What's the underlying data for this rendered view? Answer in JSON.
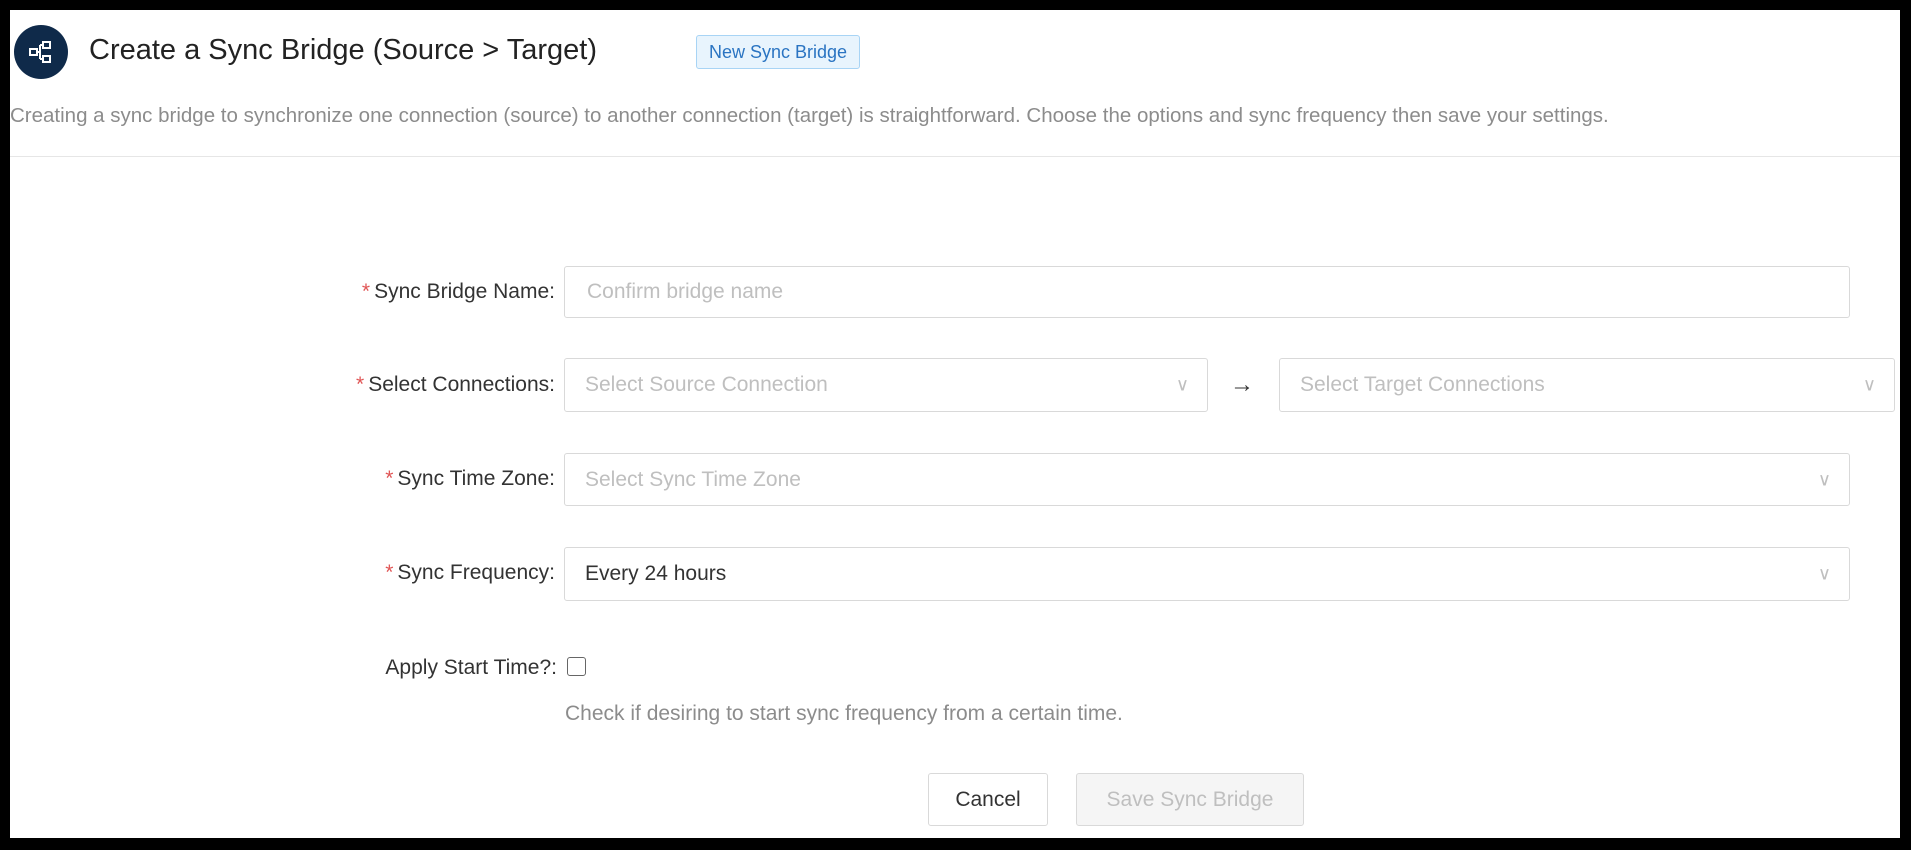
{
  "header": {
    "icon": "sync-bridge-nodes-icon",
    "title": "Create a Sync Bridge (Source > Target)",
    "badge": "New Sync Bridge",
    "description": "Creating a sync bridge to synchronize one connection (source) to another connection (target) is straightforward. Choose the options and sync frequency then save your settings."
  },
  "form": {
    "required_mark": "*",
    "name": {
      "label": "Sync Bridge Name",
      "placeholder": "Confirm bridge name",
      "value": ""
    },
    "connections": {
      "label": "Select Connections",
      "source_placeholder": "Select Source Connection",
      "target_placeholder": "Select Target Connections",
      "arrow": "→"
    },
    "time_zone": {
      "label": "Sync Time Zone",
      "placeholder": "Select Sync Time Zone"
    },
    "frequency": {
      "label": "Sync Frequency",
      "value": "Every 24 hours"
    },
    "start_time": {
      "label": "Apply Start Time?",
      "checked": false,
      "help": "Check if desiring to start sync frequency from a certain time."
    },
    "colon": ":"
  },
  "buttons": {
    "cancel": "Cancel",
    "save": "Save Sync Bridge"
  },
  "colors": {
    "brand": "#0f2a4a",
    "badge_text": "#2a74c2",
    "required": "#e05555"
  }
}
